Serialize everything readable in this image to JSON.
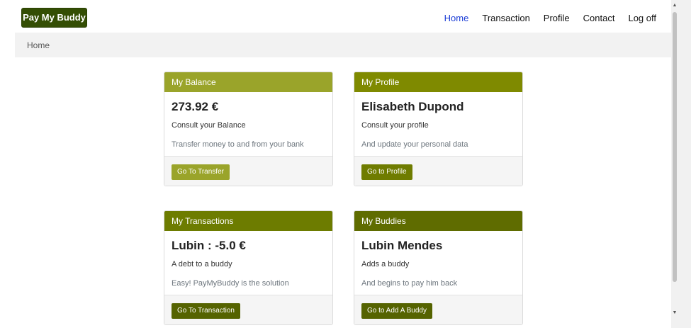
{
  "navbar": {
    "brand": "Pay My Buddy",
    "links": [
      "Home",
      "Transaction",
      "Profile",
      "Contact",
      "Log off"
    ]
  },
  "breadcrumb": {
    "current": "Home"
  },
  "cards": {
    "balance": {
      "header": "My Balance",
      "title": "273.92 €",
      "text": "Consult your Balance",
      "muted": "Transfer money to and from your bank",
      "button": "Go To Transfer"
    },
    "profile": {
      "header": "My Profile",
      "title": "Elisabeth Dupond",
      "text": "Consult your profile",
      "muted": "And update your personal data",
      "button": "Go to Profile"
    },
    "transactions": {
      "header": "My Transactions",
      "title": "Lubin : -5.0 €",
      "text": "A debt to a buddy",
      "muted": "Easy! PayMyBuddy is the solution",
      "button": "Go To Transaction"
    },
    "buddies": {
      "header": "My Buddies",
      "title": "Lubin Mendes",
      "text": "Adds a buddy",
      "muted": "And begins to pay him back",
      "button": "Go to Add A Buddy"
    }
  },
  "colors": {
    "brand_bg": "#344e04",
    "active_link": "#1a3cd6",
    "balance_header": "#9aa42a",
    "profile_header": "#7f8a00",
    "transactions_header": "#6d7c00",
    "buddies_header": "#5f6c00",
    "btn_light": "#9aa42a",
    "btn_mid": "#6f7c00",
    "btn_dark": "#556300"
  }
}
